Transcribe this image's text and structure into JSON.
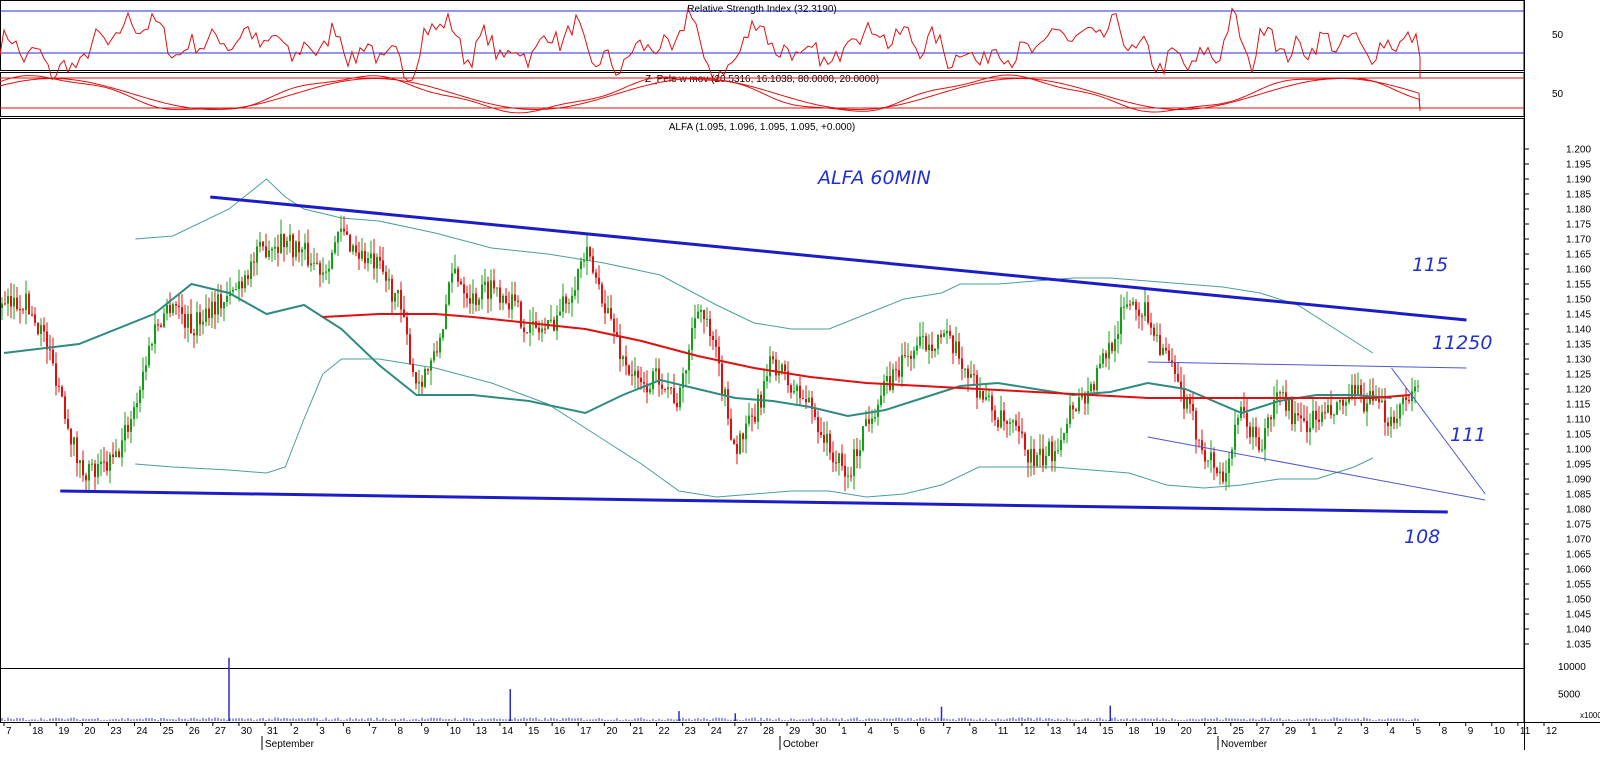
{
  "chart_data": [
    {
      "type": "line",
      "panel": "rsi",
      "title": "Relative Strength Index (32.3190)",
      "y_ticks": [
        50
      ],
      "ylim": [
        0,
        100
      ],
      "levels": [
        80,
        50
      ],
      "last_value": 32.319
    },
    {
      "type": "line",
      "panel": "stochastic",
      "title": "Z_Pele w mov (20.5316, 16.1038, 80.0000, 20.0000)",
      "y_ticks": [
        50
      ],
      "ylim": [
        0,
        100
      ],
      "levels": [
        80,
        20
      ],
      "last_k": 20.5316,
      "last_d": 16.1038
    },
    {
      "type": "candlestick",
      "panel": "price",
      "title": "ALFA (1.095, 1.096, 1.095, 1.095, +0.000)",
      "annotation": "ALFA 60MIN",
      "ylim": [
        1.03,
        1.2
      ],
      "y_ticks": [
        "1.035",
        "1.040",
        "1.045",
        "1.050",
        "1.055",
        "1.060",
        "1.065",
        "1.070",
        "1.075",
        "1.080",
        "1.085",
        "1.090",
        "1.095",
        "1.100",
        "1.105",
        "1.110",
        "1.115",
        "1.120",
        "1.125",
        "1.130",
        "1.135",
        "1.140",
        "1.145",
        "1.150",
        "1.155",
        "1.160",
        "1.165",
        "1.170",
        "1.175",
        "1.180",
        "1.185",
        "1.190",
        "1.195",
        "1.200"
      ],
      "close_path": [
        [
          0,
          1.147
        ],
        [
          1,
          1.15
        ],
        [
          2,
          1.14
        ],
        [
          3,
          1.12
        ],
        [
          4,
          1.094
        ],
        [
          5,
          1.092
        ],
        [
          6,
          1.097
        ],
        [
          7,
          1.115
        ],
        [
          8,
          1.14
        ],
        [
          9,
          1.15
        ],
        [
          10,
          1.14
        ],
        [
          11,
          1.148
        ],
        [
          12,
          1.15
        ],
        [
          13,
          1.16
        ],
        [
          14,
          1.168
        ],
        [
          15,
          1.17
        ],
        [
          16,
          1.165
        ],
        [
          17,
          1.16
        ],
        [
          18,
          1.172
        ],
        [
          19,
          1.165
        ],
        [
          20,
          1.16
        ],
        [
          21,
          1.15
        ],
        [
          22,
          1.122
        ],
        [
          23,
          1.13
        ],
        [
          24,
          1.16
        ],
        [
          25,
          1.15
        ],
        [
          26,
          1.155
        ],
        [
          27,
          1.15
        ],
        [
          28,
          1.14
        ],
        [
          29,
          1.14
        ],
        [
          30,
          1.15
        ],
        [
          31,
          1.165
        ],
        [
          32,
          1.15
        ],
        [
          33,
          1.13
        ],
        [
          34,
          1.12
        ],
        [
          35,
          1.125
        ],
        [
          36,
          1.115
        ],
        [
          37,
          1.15
        ],
        [
          38,
          1.13
        ],
        [
          39,
          1.1
        ],
        [
          40,
          1.11
        ],
        [
          41,
          1.13
        ],
        [
          42,
          1.12
        ],
        [
          43,
          1.115
        ],
        [
          44,
          1.1
        ],
        [
          45,
          1.09
        ],
        [
          46,
          1.11
        ],
        [
          47,
          1.12
        ],
        [
          48,
          1.13
        ],
        [
          49,
          1.135
        ],
        [
          50,
          1.138
        ],
        [
          51,
          1.13
        ],
        [
          52,
          1.12
        ],
        [
          53,
          1.11
        ],
        [
          54,
          1.105
        ],
        [
          55,
          1.095
        ],
        [
          56,
          1.1
        ],
        [
          57,
          1.115
        ],
        [
          58,
          1.12
        ],
        [
          59,
          1.135
        ],
        [
          60,
          1.15
        ],
        [
          61,
          1.145
        ],
        [
          62,
          1.13
        ],
        [
          63,
          1.115
        ],
        [
          64,
          1.1
        ],
        [
          65,
          1.09
        ],
        [
          66,
          1.112
        ],
        [
          67,
          1.1
        ],
        [
          68,
          1.12
        ],
        [
          69,
          1.108
        ],
        [
          70,
          1.11
        ],
        [
          71,
          1.112
        ],
        [
          72,
          1.118
        ],
        [
          73,
          1.115
        ],
        [
          74,
          1.11
        ],
        [
          75,
          1.12
        ],
        [
          76,
          1.115
        ],
        [
          77,
          1.105
        ],
        [
          78,
          1.095
        ]
      ],
      "moving_average_fast": [
        [
          0,
          1.132
        ],
        [
          4,
          1.135
        ],
        [
          8,
          1.145
        ],
        [
          10,
          1.155
        ],
        [
          12,
          1.152
        ],
        [
          14,
          1.145
        ],
        [
          16,
          1.148
        ],
        [
          18,
          1.14
        ],
        [
          20,
          1.128
        ],
        [
          22,
          1.118
        ],
        [
          25,
          1.118
        ],
        [
          28,
          1.116
        ],
        [
          31,
          1.112
        ],
        [
          33,
          1.118
        ],
        [
          35,
          1.123
        ],
        [
          37,
          1.12
        ],
        [
          39,
          1.117
        ],
        [
          41,
          1.116
        ],
        [
          43,
          1.114
        ],
        [
          45,
          1.111
        ],
        [
          47,
          1.113
        ],
        [
          49,
          1.117
        ],
        [
          51,
          1.121
        ],
        [
          53,
          1.122
        ],
        [
          55,
          1.12
        ],
        [
          57,
          1.118
        ],
        [
          59,
          1.119
        ],
        [
          61,
          1.122
        ],
        [
          63,
          1.12
        ],
        [
          66,
          1.112
        ],
        [
          68,
          1.116
        ],
        [
          70,
          1.118
        ],
        [
          72,
          1.118
        ],
        [
          74,
          1.117
        ]
      ],
      "moving_average_slow": [
        [
          17,
          1.144
        ],
        [
          20,
          1.145
        ],
        [
          23,
          1.145
        ],
        [
          25,
          1.144
        ],
        [
          28,
          1.142
        ],
        [
          31,
          1.14
        ],
        [
          34,
          1.136
        ],
        [
          37,
          1.131
        ],
        [
          40,
          1.127
        ],
        [
          43,
          1.124
        ],
        [
          46,
          1.122
        ],
        [
          49,
          1.121
        ],
        [
          52,
          1.12
        ],
        [
          55,
          1.119
        ],
        [
          58,
          1.118
        ],
        [
          61,
          1.117
        ],
        [
          64,
          1.117
        ],
        [
          67,
          1.117
        ],
        [
          70,
          1.117
        ],
        [
          73,
          1.117
        ],
        [
          75,
          1.118
        ]
      ],
      "bollinger_upper": [
        [
          7,
          1.17
        ],
        [
          9,
          1.171
        ],
        [
          12,
          1.18
        ],
        [
          13,
          1.185
        ],
        [
          14,
          1.19
        ],
        [
          15,
          1.184
        ],
        [
          16,
          1.18
        ],
        [
          18,
          1.177
        ],
        [
          20,
          1.176
        ],
        [
          23,
          1.172
        ],
        [
          26,
          1.167
        ],
        [
          29,
          1.165
        ],
        [
          32,
          1.162
        ],
        [
          35,
          1.158
        ],
        [
          38,
          1.148
        ],
        [
          40,
          1.142
        ],
        [
          42,
          1.14
        ],
        [
          44,
          1.14
        ],
        [
          46,
          1.145
        ],
        [
          48,
          1.15
        ],
        [
          50,
          1.152
        ],
        [
          51,
          1.155
        ],
        [
          53,
          1.155
        ],
        [
          55,
          1.156
        ],
        [
          57,
          1.157
        ],
        [
          59,
          1.157
        ],
        [
          61,
          1.156
        ],
        [
          63,
          1.155
        ],
        [
          65,
          1.154
        ],
        [
          67,
          1.152
        ],
        [
          69,
          1.148
        ],
        [
          71,
          1.14
        ],
        [
          73,
          1.132
        ]
      ],
      "bollinger_lower": [
        [
          7,
          1.095
        ],
        [
          9,
          1.094
        ],
        [
          12,
          1.093
        ],
        [
          14,
          1.092
        ],
        [
          15,
          1.094
        ],
        [
          16,
          1.11
        ],
        [
          17,
          1.125
        ],
        [
          18,
          1.13
        ],
        [
          20,
          1.13
        ],
        [
          23,
          1.127
        ],
        [
          26,
          1.122
        ],
        [
          29,
          1.115
        ],
        [
          32,
          1.103
        ],
        [
          34,
          1.095
        ],
        [
          36,
          1.086
        ],
        [
          38,
          1.084
        ],
        [
          40,
          1.085
        ],
        [
          42,
          1.086
        ],
        [
          44,
          1.086
        ],
        [
          46,
          1.084
        ],
        [
          48,
          1.085
        ],
        [
          50,
          1.088
        ],
        [
          52,
          1.094
        ],
        [
          54,
          1.094
        ],
        [
          56,
          1.094
        ],
        [
          58,
          1.093
        ],
        [
          60,
          1.092
        ],
        [
          62,
          1.088
        ],
        [
          64,
          1.087
        ],
        [
          66,
          1.088
        ],
        [
          68,
          1.09
        ],
        [
          70,
          1.09
        ],
        [
          72,
          1.094
        ],
        [
          73,
          1.097
        ]
      ],
      "trendlines": [
        {
          "from": [
            11,
            1.184
          ],
          "to": [
            78,
            1.143
          ],
          "color": "#1c1cc8",
          "label": "115"
        },
        {
          "from": [
            3,
            1.086
          ],
          "to": [
            77,
            1.079
          ],
          "color": "#1c1cc8",
          "label": "108"
        },
        {
          "from": [
            61,
            1.129
          ],
          "to": [
            78,
            1.127
          ],
          "color": "#4c57d8",
          "label": "11250"
        },
        {
          "from": [
            61,
            1.104
          ],
          "to": [
            79,
            1.083
          ],
          "color": "#4c57d8",
          "label": ""
        },
        {
          "from": [
            74,
            1.127
          ],
          "to": [
            79,
            1.085
          ],
          "color": "#4c57d8",
          "label": "111"
        }
      ],
      "price_labels": [
        "115",
        "11250",
        "111",
        "108"
      ]
    },
    {
      "type": "bar",
      "panel": "volume",
      "y_ticks": [
        "10000",
        "5000"
      ],
      "unit": "x1000",
      "spikes": [
        [
          12,
          11500
        ],
        [
          27,
          5800
        ],
        [
          50,
          2600
        ],
        [
          59,
          2800
        ],
        [
          36,
          1800
        ],
        [
          39,
          1400
        ]
      ]
    }
  ],
  "x_axis": {
    "day_labels": [
      "7",
      "18",
      "19",
      "20",
      "23",
      "24",
      "25",
      "26",
      "27",
      "30",
      "31",
      "2",
      "3",
      "6",
      "7",
      "8",
      "9",
      "10",
      "13",
      "14",
      "15",
      "16",
      "17",
      "20",
      "21",
      "22",
      "23",
      "24",
      "27",
      "28",
      "29",
      "30",
      "1",
      "4",
      "5",
      "6",
      "7",
      "8",
      "11",
      "12",
      "13",
      "14",
      "15",
      "18",
      "19",
      "20",
      "21",
      "25",
      "27",
      "29",
      "1",
      "2",
      "3",
      "4",
      "5",
      "8",
      "9",
      "10",
      "11",
      "12"
    ],
    "month_labels": [
      "September",
      "October",
      "November"
    ]
  }
}
